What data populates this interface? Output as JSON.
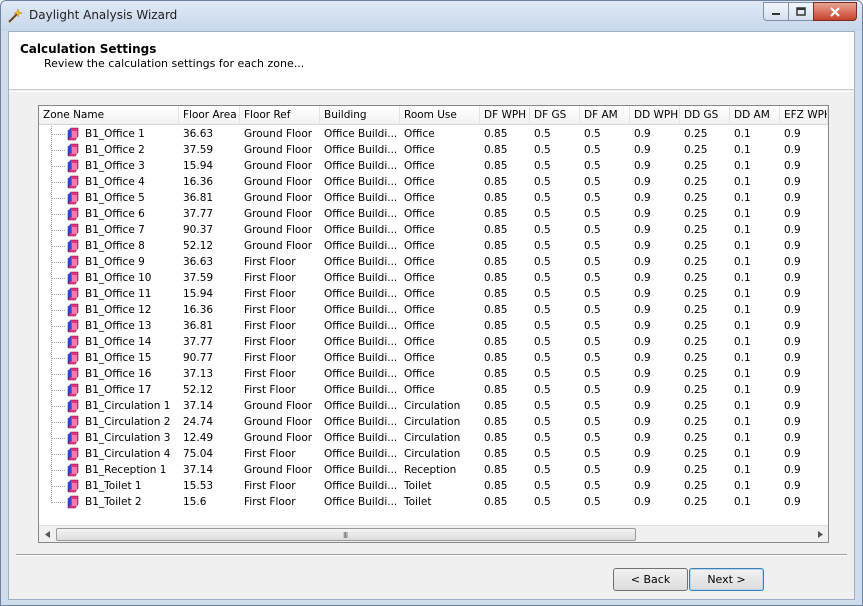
{
  "window": {
    "title": "Daylight Analysis Wizard"
  },
  "header": {
    "title": "Calculation Settings",
    "subtitle": "Review the calculation settings for each zone..."
  },
  "grid": {
    "columns": [
      "Zone Name",
      "Floor Area",
      "Floor Ref",
      "Building",
      "Room Use",
      "DF WPH",
      "DF GS",
      "DF AM",
      "DD WPH",
      "DD GS",
      "DD AM",
      "EFZ WPH"
    ],
    "rows": [
      [
        "B1_Office 1",
        "36.63",
        "Ground Floor",
        "Office Buildi...",
        "Office",
        "0.85",
        "0.5",
        "0.5",
        "0.9",
        "0.25",
        "0.1",
        "0.9"
      ],
      [
        "B1_Office 2",
        "37.59",
        "Ground Floor",
        "Office Buildi...",
        "Office",
        "0.85",
        "0.5",
        "0.5",
        "0.9",
        "0.25",
        "0.1",
        "0.9"
      ],
      [
        "B1_Office 3",
        "15.94",
        "Ground Floor",
        "Office Buildi...",
        "Office",
        "0.85",
        "0.5",
        "0.5",
        "0.9",
        "0.25",
        "0.1",
        "0.9"
      ],
      [
        "B1_Office 4",
        "16.36",
        "Ground Floor",
        "Office Buildi...",
        "Office",
        "0.85",
        "0.5",
        "0.5",
        "0.9",
        "0.25",
        "0.1",
        "0.9"
      ],
      [
        "B1_Office 5",
        "36.81",
        "Ground Floor",
        "Office Buildi...",
        "Office",
        "0.85",
        "0.5",
        "0.5",
        "0.9",
        "0.25",
        "0.1",
        "0.9"
      ],
      [
        "B1_Office 6",
        "37.77",
        "Ground Floor",
        "Office Buildi...",
        "Office",
        "0.85",
        "0.5",
        "0.5",
        "0.9",
        "0.25",
        "0.1",
        "0.9"
      ],
      [
        "B1_Office 7",
        "90.37",
        "Ground Floor",
        "Office Buildi...",
        "Office",
        "0.85",
        "0.5",
        "0.5",
        "0.9",
        "0.25",
        "0.1",
        "0.9"
      ],
      [
        "B1_Office 8",
        "52.12",
        "Ground Floor",
        "Office Buildi...",
        "Office",
        "0.85",
        "0.5",
        "0.5",
        "0.9",
        "0.25",
        "0.1",
        "0.9"
      ],
      [
        "B1_Office 9",
        "36.63",
        "First Floor",
        "Office Buildi...",
        "Office",
        "0.85",
        "0.5",
        "0.5",
        "0.9",
        "0.25",
        "0.1",
        "0.9"
      ],
      [
        "B1_Office 10",
        "37.59",
        "First Floor",
        "Office Buildi...",
        "Office",
        "0.85",
        "0.5",
        "0.5",
        "0.9",
        "0.25",
        "0.1",
        "0.9"
      ],
      [
        "B1_Office 11",
        "15.94",
        "First Floor",
        "Office Buildi...",
        "Office",
        "0.85",
        "0.5",
        "0.5",
        "0.9",
        "0.25",
        "0.1",
        "0.9"
      ],
      [
        "B1_Office 12",
        "16.36",
        "First Floor",
        "Office Buildi...",
        "Office",
        "0.85",
        "0.5",
        "0.5",
        "0.9",
        "0.25",
        "0.1",
        "0.9"
      ],
      [
        "B1_Office 13",
        "36.81",
        "First Floor",
        "Office Buildi...",
        "Office",
        "0.85",
        "0.5",
        "0.5",
        "0.9",
        "0.25",
        "0.1",
        "0.9"
      ],
      [
        "B1_Office 14",
        "37.77",
        "First Floor",
        "Office Buildi...",
        "Office",
        "0.85",
        "0.5",
        "0.5",
        "0.9",
        "0.25",
        "0.1",
        "0.9"
      ],
      [
        "B1_Office 15",
        "90.77",
        "First Floor",
        "Office Buildi...",
        "Office",
        "0.85",
        "0.5",
        "0.5",
        "0.9",
        "0.25",
        "0.1",
        "0.9"
      ],
      [
        "B1_Office 16",
        "37.13",
        "First Floor",
        "Office Buildi...",
        "Office",
        "0.85",
        "0.5",
        "0.5",
        "0.9",
        "0.25",
        "0.1",
        "0.9"
      ],
      [
        "B1_Office 17",
        "52.12",
        "First Floor",
        "Office Buildi...",
        "Office",
        "0.85",
        "0.5",
        "0.5",
        "0.9",
        "0.25",
        "0.1",
        "0.9"
      ],
      [
        "B1_Circulation 1",
        "37.14",
        "Ground Floor",
        "Office Buildi...",
        "Circulation",
        "0.85",
        "0.5",
        "0.5",
        "0.9",
        "0.25",
        "0.1",
        "0.9"
      ],
      [
        "B1_Circulation 2",
        "24.74",
        "Ground Floor",
        "Office Buildi...",
        "Circulation",
        "0.85",
        "0.5",
        "0.5",
        "0.9",
        "0.25",
        "0.1",
        "0.9"
      ],
      [
        "B1_Circulation 3",
        "12.49",
        "Ground Floor",
        "Office Buildi...",
        "Circulation",
        "0.85",
        "0.5",
        "0.5",
        "0.9",
        "0.25",
        "0.1",
        "0.9"
      ],
      [
        "B1_Circulation 4",
        "75.04",
        "First Floor",
        "Office Buildi...",
        "Circulation",
        "0.85",
        "0.5",
        "0.5",
        "0.9",
        "0.25",
        "0.1",
        "0.9"
      ],
      [
        "B1_Reception 1",
        "37.14",
        "Ground Floor",
        "Office Buildi...",
        "Reception",
        "0.85",
        "0.5",
        "0.5",
        "0.9",
        "0.25",
        "0.1",
        "0.9"
      ],
      [
        "B1_Toilet 1",
        "15.53",
        "First Floor",
        "Office Buildi...",
        "Toilet",
        "0.85",
        "0.5",
        "0.5",
        "0.9",
        "0.25",
        "0.1",
        "0.9"
      ],
      [
        "B1_Toilet 2",
        "15.6",
        "First Floor",
        "Office Buildi...",
        "Toilet",
        "0.85",
        "0.5",
        "0.5",
        "0.9",
        "0.25",
        "0.1",
        "0.9"
      ]
    ],
    "scrollbar_grip": "III"
  },
  "buttons": {
    "back": "< Back",
    "next": "Next >"
  },
  "colors": {
    "zone_icon": "#e0337c",
    "zone_icon_side": "#3b44c8"
  }
}
